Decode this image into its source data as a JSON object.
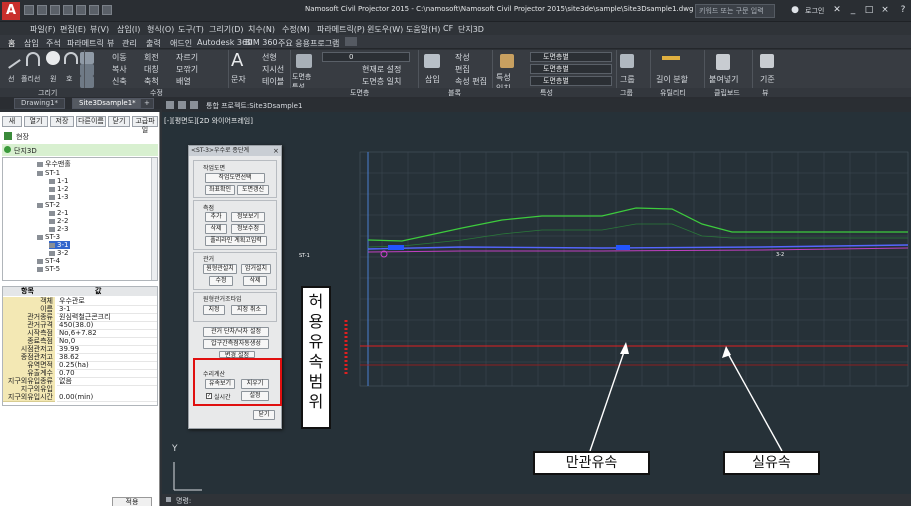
{
  "title_bar": {
    "title": "Namosoft Civil Projector 2015 - C:\\namosoft\\Namosoft Civil Projector 2015\\site3de\\sample\\Site3Dsample1.dwg",
    "search_placeholder": "키워드 또는 구문 입력",
    "login": "로그인",
    "help": "?"
  },
  "menu": [
    "파일(F)",
    "편집(E)",
    "뷰(V)",
    "삽입(I)",
    "형식(O)",
    "도구(T)",
    "그리기(D)",
    "치수(N)",
    "수정(M)",
    "파라메트릭(P)",
    "윈도우(W)",
    "도움말(H)",
    "CF",
    "단지3D"
  ],
  "ribbon_tabs": [
    "홈",
    "삽입",
    "주석",
    "파라메트릭",
    "뷰",
    "관리",
    "출력",
    "애드인",
    "Autodesk 360",
    "BIM 360",
    "주요 응용프로그램"
  ],
  "ribbon": {
    "groups": [
      "그리기",
      "수정",
      "도면층",
      "블록",
      "특성",
      "그룹",
      "유틸리티",
      "클립보드",
      "뷰"
    ],
    "draw_tools": [
      "선",
      "폴리선",
      "원",
      "호"
    ],
    "modify_tools": [
      "이동",
      "회전",
      "자르기",
      "복사",
      "대칭",
      "모깎기",
      "신축",
      "축척",
      "배열"
    ],
    "text_tool": "문자",
    "annotation_tools": [
      "선형",
      "지시선",
      "테이블"
    ],
    "layer_tools": [
      "도면층 특성",
      "현재로 설정",
      "도면층 일치"
    ],
    "layer_value": "0",
    "insert": "삽입",
    "block_tools": [
      "작성",
      "편집",
      "속성 편집"
    ],
    "property_match": "특성 일치",
    "bylayer": "도면층별",
    "group": "그룹",
    "measure": "길이 분할",
    "paste": "붙여넣기",
    "base": "기준"
  },
  "doc_tabs": [
    "Drawing1*",
    "Site3Dsample1*",
    "+"
  ],
  "drawing_header": {
    "mode": "통합 프로젝트:Site3Dsample1"
  },
  "viewport_title": "[-][평면도][2D 와이어프레임]",
  "left_panel": {
    "toolbar": [
      "새",
      "열기",
      "저장",
      "다른이름",
      "닫기",
      "고급파일"
    ],
    "root": "현장",
    "tree_header": "단지3D",
    "tree": [
      {
        "label": "우수맨홀",
        "level": 1
      },
      {
        "label": "ST-1",
        "level": 1
      },
      {
        "label": "1-1",
        "level": 2
      },
      {
        "label": "1-2",
        "level": 2
      },
      {
        "label": "1-3",
        "level": 2
      },
      {
        "label": "ST-2",
        "level": 1
      },
      {
        "label": "2-1",
        "level": 2
      },
      {
        "label": "2-2",
        "level": 2
      },
      {
        "label": "2-3",
        "level": 2
      },
      {
        "label": "ST-3",
        "level": 1
      },
      {
        "label": "3-1",
        "level": 2,
        "selected": true
      },
      {
        "label": "3-2",
        "level": 2
      },
      {
        "label": "ST-4",
        "level": 1
      },
      {
        "label": "ST-5",
        "level": 1
      }
    ],
    "props_header": [
      "항목",
      "값"
    ],
    "props": [
      [
        "객체",
        "우수관로"
      ],
      [
        "이름",
        "3-1"
      ],
      [
        "관거종류",
        "원심력철근콘크리"
      ],
      [
        "관거규격",
        "450(38.0)"
      ],
      [
        "시작측점",
        "No,6+7.82"
      ],
      [
        "종료측점",
        "No,0"
      ],
      [
        "시점관저고",
        "39.99"
      ],
      [
        "종점관저고",
        "38.62"
      ],
      [
        "유역면적",
        "0.25(ha)"
      ],
      [
        "유출계수",
        "0.70"
      ],
      [
        "지구외유입종류",
        "없음"
      ],
      [
        "지구외유입",
        ""
      ],
      [
        "지구외유입시간",
        "0.00(min)"
      ]
    ],
    "bottom_button": "적용"
  },
  "dialog": {
    "title": "<ST-3>우수로 종단계",
    "sec_work": "작업도면",
    "btn_select_work": "작업도면선택",
    "btn_coord": "좌표확인",
    "btn_update": "도면갱신",
    "sec_measure": "측점",
    "btn_add": "추가",
    "btn_info_view": "정보보기",
    "btn_delete": "삭제",
    "btn_info_edit": "정보수정",
    "btn_polyline": "폴리라인 계획고입력",
    "sec_pipe": "관거",
    "btn_manhole_install": "원형관설치",
    "btn_auto_install": "암거설치",
    "btn_edit": "수정",
    "btn_del2": "삭제",
    "sec_manhole": "원형관거조타입",
    "btn_assign": "지정",
    "btn_unassign": "지정 취소",
    "btn_pipe_setup": "관거 단차/낙차 설정",
    "btn_pressure": "압구간측점자동생성",
    "btn_extra": "변경 설정",
    "sec_hydro": "수리계산",
    "btn_flow_view": "유속보기",
    "btn_rm": "지우기",
    "chk_realtime": "실시간",
    "btn_setting": "설정",
    "btn_close": "닫기"
  },
  "callouts": {
    "vertical": [
      "허",
      "용",
      "유",
      "속",
      "범",
      "위"
    ],
    "pipe_full_velocity": "만관유속",
    "actual_velocity": "실유속"
  },
  "profile": {
    "station_labels": [
      "ST-1",
      "3-2"
    ],
    "y_axis_label": "Y"
  },
  "command_prompt": "명령:",
  "colors": {
    "accent_red": "#e01010",
    "ground_line": "#3dcc3d",
    "pipe_line": "#3355ff",
    "velocity_red": "#e02020"
  }
}
